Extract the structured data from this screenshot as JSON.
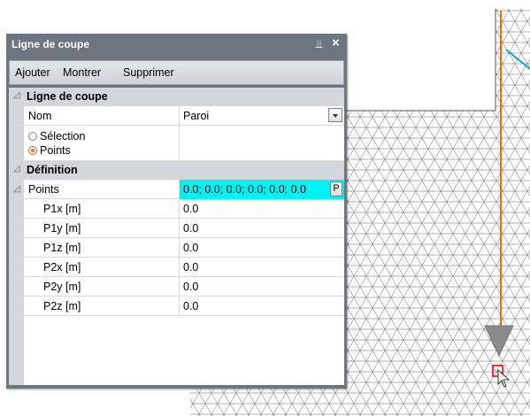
{
  "panel": {
    "title": "Ligne de coupe",
    "pin_icon": "pin-icon",
    "close_icon": "close-icon",
    "pin_glyph": "⫫",
    "close_glyph": "×"
  },
  "toolbar": {
    "add_label": "Ajouter",
    "show_label": "Montrer",
    "delete_label": "Supprimer"
  },
  "section1": {
    "title": "Ligne de coupe",
    "name_label": "Nom",
    "name_value": "Paroi",
    "radio_selection": "Sélection",
    "radio_points": "Points",
    "selected_radio": "Points"
  },
  "section2": {
    "title": "Définition",
    "points_label": "Points",
    "points_value": "0.0; 0.0; 0.0; 0.0; 0.0; 0.0",
    "points_button": "P",
    "rows": [
      {
        "label": "P1x [m]",
        "value": "0.0"
      },
      {
        "label": "P1y [m]",
        "value": "0.0"
      },
      {
        "label": "P1z [m]",
        "value": "0.0"
      },
      {
        "label": "P2x [m]",
        "value": "0.0"
      },
      {
        "label": "P2y [m]",
        "value": "0.0"
      },
      {
        "label": "P2z [m]",
        "value": "0.0"
      }
    ]
  },
  "colors": {
    "panel_title_bg": "#6d7580",
    "highlight": "#00f2f2",
    "section_line": "#ff6a00",
    "mesh_line": "#666666",
    "marker": "#ff0000",
    "accent_line": "#1aa0d8"
  }
}
